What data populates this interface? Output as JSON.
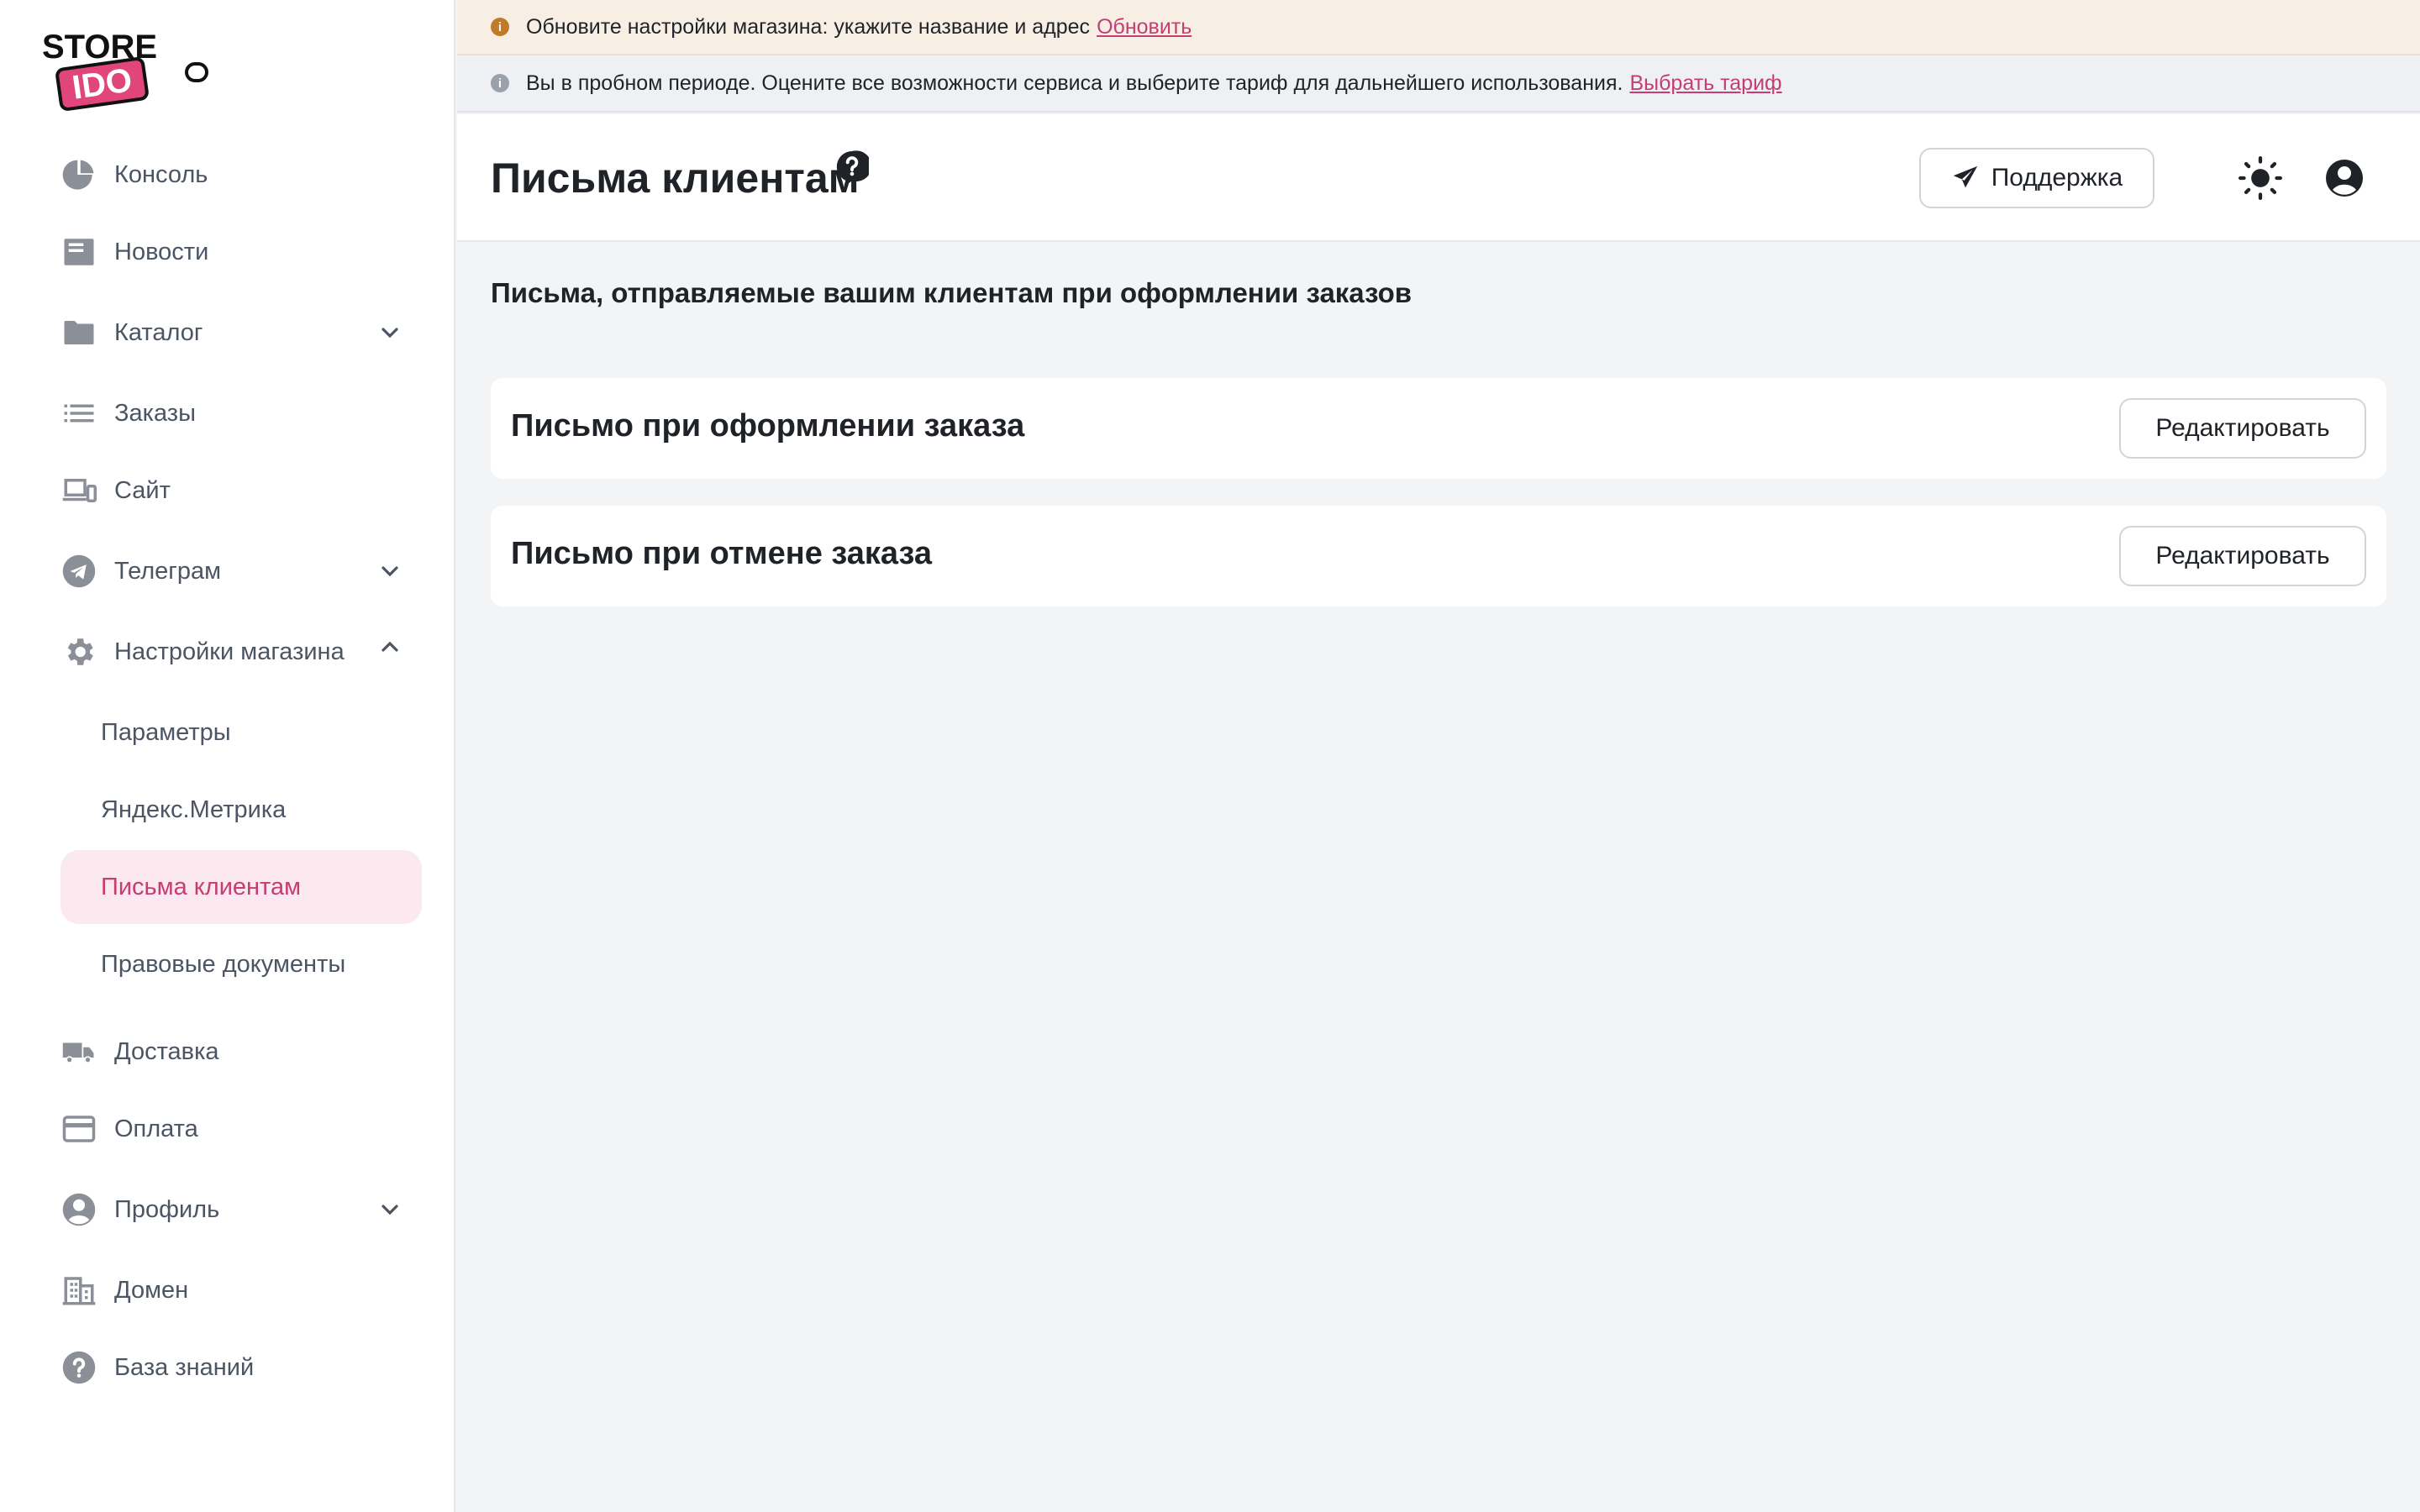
{
  "logo": {
    "top": "STORE",
    "bottom": "IDO"
  },
  "sidebar": {
    "items": [
      {
        "label": "Консоль",
        "icon": "pie-chart-icon"
      },
      {
        "label": "Новости",
        "icon": "newspaper-icon"
      },
      {
        "label": "Каталог",
        "icon": "folder-icon",
        "expandable": true
      },
      {
        "label": "Заказы",
        "icon": "list-icon"
      },
      {
        "label": "Сайт",
        "icon": "devices-icon"
      },
      {
        "label": "Телеграм",
        "icon": "telegram-icon",
        "expandable": true
      },
      {
        "label": "Настройки магазина",
        "icon": "gear-icon",
        "expanded": true
      },
      {
        "label": "Доставка",
        "icon": "truck-icon"
      },
      {
        "label": "Оплата",
        "icon": "credit-card-icon"
      },
      {
        "label": "Профиль",
        "icon": "user-circle-icon",
        "expandable": true
      },
      {
        "label": "Домен",
        "icon": "building-icon"
      },
      {
        "label": "База знаний",
        "icon": "question-circle-icon"
      }
    ],
    "settings_sub": [
      {
        "label": "Параметры"
      },
      {
        "label": "Яндекс.Метрика"
      },
      {
        "label": "Письма клиентам",
        "active": true
      },
      {
        "label": "Правовые документы"
      }
    ]
  },
  "banners": {
    "warning": {
      "text": "Обновите настройки магазина: укажите название и адрес",
      "link": "Обновить"
    },
    "info": {
      "text": "Вы в пробном периоде. Оцените все возможности сервиса и выберите тариф для дальнейшего использования.",
      "link": "Выбрать тариф"
    }
  },
  "header": {
    "title": "Письма клиентам",
    "support_label": "Поддержка"
  },
  "main": {
    "section_title": "Письма, отправляемые вашим клиентам при оформлении заказов",
    "cards": [
      {
        "title": "Письмо при оформлении заказа",
        "button": "Редактировать"
      },
      {
        "title": "Письмо при отмене заказа",
        "button": "Редактировать"
      }
    ]
  },
  "colors": {
    "accent": "#c43e73",
    "active_bg": "#fbe9ef",
    "warning_banner": "#f8efe4",
    "info_banner": "#eef0f3"
  }
}
